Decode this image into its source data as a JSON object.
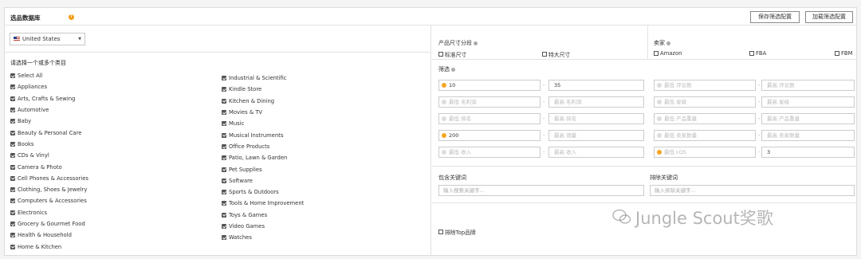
{
  "header": {
    "title": "选品数据库",
    "save_btn": "保存筛选配置",
    "load_btn": "加载筛选配置"
  },
  "country": {
    "selected": "United States"
  },
  "categories": {
    "prompt": "请选择一个或多个类目",
    "col1": [
      "Select All",
      "Appliances",
      "Arts, Crafts & Sewing",
      "Automotive",
      "Baby",
      "Beauty & Personal Care",
      "Books",
      "CDs & Vinyl",
      "Camera & Photo",
      "Cell Phones & Accessories",
      "Clothing, Shoes & Jewelry",
      "Computers & Accessories",
      "Electronics",
      "Grocery & Gourmet Food",
      "Health & Household",
      "Home & Kitchen"
    ],
    "col2": [
      "Industrial & Scientific",
      "Kindle Store",
      "Kitchen & Dining",
      "Movies & TV",
      "Music",
      "Musical Instruments",
      "Office Products",
      "Patio, Lawn & Garden",
      "Pet Supplies",
      "Software",
      "Sports & Outdoors",
      "Tools & Home Improvement",
      "Toys & Games",
      "Video Games",
      "Watches"
    ]
  },
  "size": {
    "label": "产品尺寸分段",
    "opt1": "标准尺寸",
    "opt2": "特大尺寸"
  },
  "seller": {
    "label": "卖家",
    "opt1": "Amazon",
    "opt2": "FBA",
    "opt3": "FBM"
  },
  "filter": {
    "label": "筛选",
    "rows": [
      {
        "a_min": "10",
        "a_max": "35",
        "b_min": "最低 评论数",
        "b_max": "最高 评论数"
      },
      {
        "a_min": "最低 毛利润",
        "a_max": "最高 毛利润",
        "b_min": "最低 星级",
        "b_max": "最高 星级"
      },
      {
        "a_min": "最低 排名",
        "a_max": "最高 排名",
        "b_min": "最低 产品重量",
        "b_max": "最高 产品重量"
      },
      {
        "a_min": "200",
        "a_max": "最高 销量",
        "b_min": "最低 卖家数量",
        "b_max": "最高 卖家数量"
      },
      {
        "a_min": "最低 收入",
        "a_max": "最高 收入",
        "b_min": "最低 LQS",
        "b_max": "3"
      }
    ]
  },
  "keywords": {
    "include_label": "包含关键词",
    "include_placeholder": "输入搜索关键字...",
    "exclude_label": "排除关键词",
    "exclude_placeholder": "输入排除关键字..."
  },
  "exclude_top": {
    "label": "排除Top品牌"
  },
  "watermark": "Jungle Scout奖歌"
}
